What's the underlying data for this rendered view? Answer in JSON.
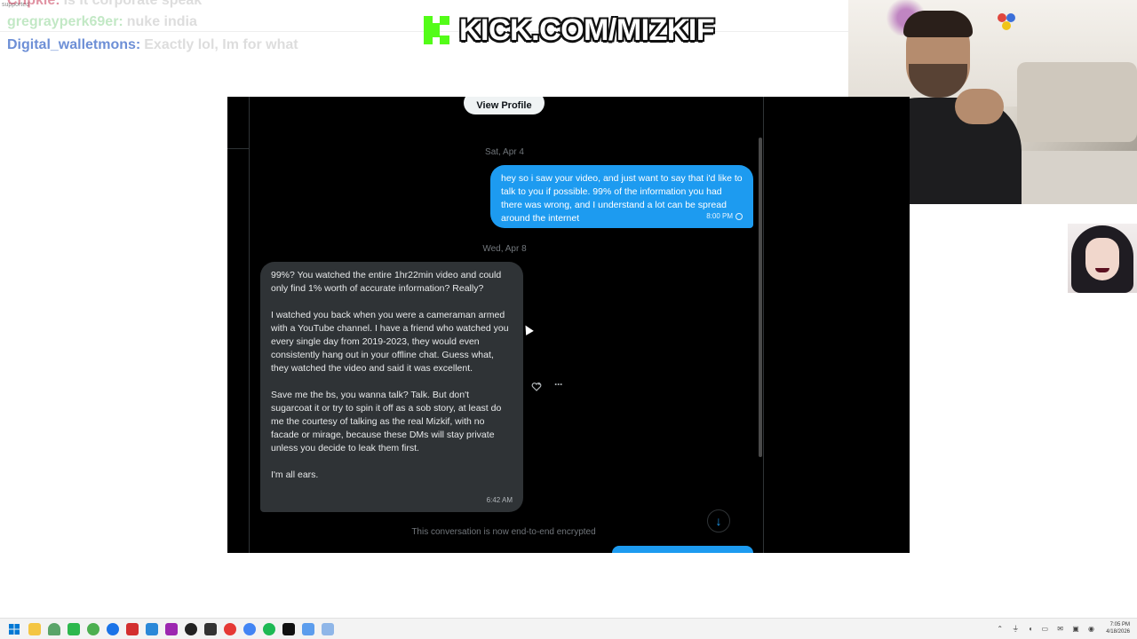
{
  "overlay_chat": {
    "tiny_label": "supported",
    "lines": [
      {
        "user": "Cripkie",
        "message": "Is it corporate speak"
      },
      {
        "user": "gregrayperk69er",
        "message": "nuke india"
      },
      {
        "user": "Digital_walletmons",
        "message": "Exactly lol, Im for what"
      }
    ]
  },
  "banner": {
    "text": "KICK.COM/MIZKIF",
    "accent": "#53fc18"
  },
  "dm": {
    "view_profile": "View Profile",
    "date1": "Sat, Apr 4",
    "sent_message": "hey so i saw your video, and just want to say that i'd like to talk to you if possible. 99% of the information you had there was wrong, and I understand a lot can be spread around the internet",
    "sent_time": "8:00 PM",
    "date2": "Wed, Apr 8",
    "received_paragraphs": [
      "99%? You watched the entire 1hr22min video and could only find 1% worth of accurate information? Really?",
      "I watched you back when you were a cameraman armed with a YouTube channel. I have a friend who watched you every single day from 2019-2023, they would even consistently hang out in your offline chat. Guess what, they watched the video and said it was excellent.",
      "Save me the bs, you wanna talk? Talk. But don't sugarcoat it or try to spin it off as a sob story, at least do me the courtesy of talking as the real Mizkif, with no facade or mirage, because these DMs will stay private unless you decide to leak them first.",
      "I'm all ears."
    ],
    "received_time": "6:42 AM",
    "more_label": "···",
    "scroll_down_glyph": "↓",
    "encrypted_note": "This conversation is now end-to-end encrypted",
    "colors": {
      "sent_bubble": "#1d9bf0",
      "received_bubble": "#2f3336",
      "background": "#000000"
    }
  },
  "taskbar": {
    "time": "7:05 PM",
    "date": "4/18/2026"
  }
}
